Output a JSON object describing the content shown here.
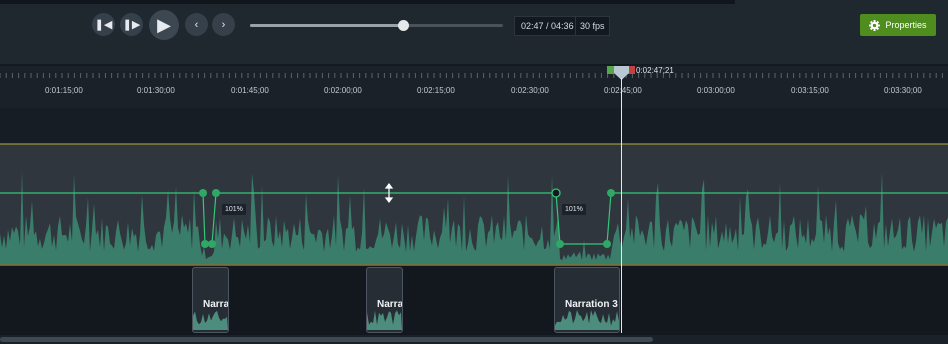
{
  "toolbar": {
    "time_current": "02:47",
    "time_separator": " / ",
    "time_total": "04:36",
    "fps": "30 fps",
    "properties_label": "Properties",
    "progress_fraction": 0.605
  },
  "ruler": {
    "ticks": [
      "0:01:15;00",
      "0:01:30;00",
      "0:01:45;00",
      "0:02:00;00",
      "0:02:15;00",
      "0:02:30;00",
      "0:02:45;00",
      "0:03:00;00",
      "0:03:15;00",
      "0:03:30;00"
    ],
    "playhead_time": "0:02:47;21"
  },
  "audio": {
    "volume_labels": [
      "101%",
      "101%"
    ]
  },
  "clips": [
    {
      "title": "Narra"
    },
    {
      "title": "Narra"
    },
    {
      "title": "Narration 3"
    }
  ],
  "colors": {
    "accent_green": "#4f8d1f",
    "waveform": "#3a7d6a",
    "envelope": "#35c878",
    "track_edge": "#b8ae3a"
  },
  "icons": [
    "rewind-icon",
    "step-forward-icon",
    "play-icon",
    "previous-icon",
    "next-icon",
    "gear-icon",
    "resize-cursor-icon"
  ]
}
